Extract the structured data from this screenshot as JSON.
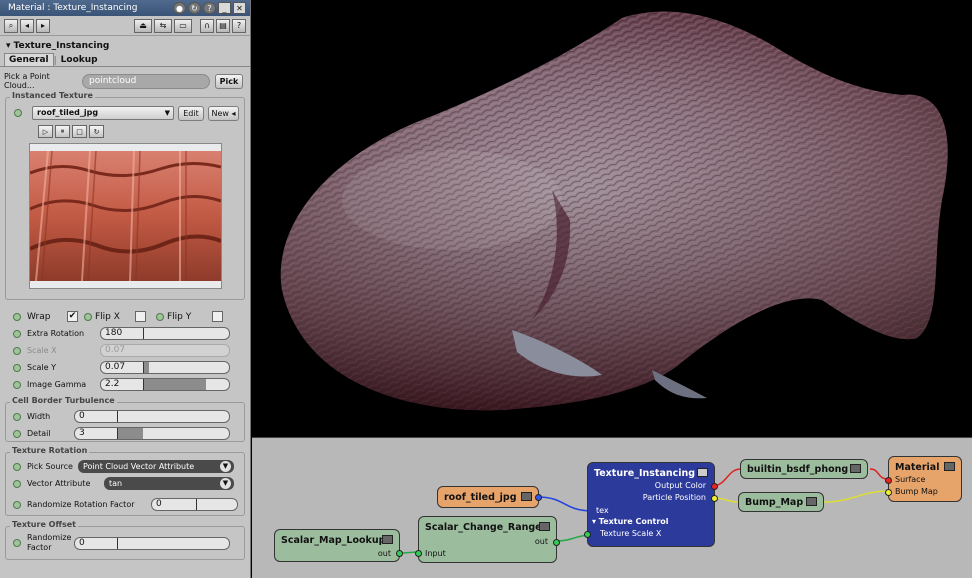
{
  "window": {
    "title": "Material : Texture_Instancing"
  },
  "panel": {
    "node_name": "Texture_Instancing",
    "tabs": [
      "General",
      "Lookup"
    ],
    "pick_label": "Pick a Point Cloud...",
    "pick_value": "pointcloud",
    "pick_button": "Pick",
    "instanced_texture": {
      "title": "Instanced Texture",
      "texture_name": "roof_tiled_jpg",
      "edit_label": "Edit",
      "new_label": "New"
    },
    "options": {
      "wrap_label": "Wrap",
      "wrap_checked": "✔",
      "flipx_label": "Flip X",
      "flipy_label": "Flip Y"
    },
    "params": {
      "extra_rotation": {
        "label": "Extra Rotation",
        "value": "180",
        "fraction": 0.5
      },
      "scale_x": {
        "label": "Scale X",
        "value": "0.07"
      },
      "scale_y": {
        "label": "Scale Y",
        "value": "0.07",
        "fraction": 0.07
      },
      "image_gamma": {
        "label": "Image Gamma",
        "value": "2.2",
        "fraction": 0.73
      }
    },
    "cell_border": {
      "title": "Cell Border Turbulence",
      "width": {
        "label": "Width",
        "value": "0",
        "fraction": 0
      },
      "detail": {
        "label": "Detail",
        "value": "3",
        "fraction": 0.23
      }
    },
    "rotation": {
      "title": "Texture Rotation",
      "pick_source_label": "Pick Source",
      "pick_source_value": "Point Cloud Vector Attribute",
      "vector_attr_label": "Vector Attribute",
      "vector_attr_value": "tan",
      "randomize_label": "Randomize Rotation Factor",
      "randomize_value": "0"
    },
    "offset": {
      "title": "Texture Offset",
      "randomize_label": "Randomize Factor",
      "randomize_value": "0"
    }
  },
  "graph": {
    "nodes": {
      "roof": {
        "title": "roof_tiled_jpg"
      },
      "texinst": {
        "title": "Texture_Instancing",
        "port_tex": "tex",
        "port_out_color": "Output Color",
        "port_particle": "Particle Position",
        "section": "▾ Texture Control",
        "port_scale": "Texture Scale X"
      },
      "phong": {
        "title": "builtin_bsdf_phong"
      },
      "bump": {
        "title": "Bump_Map"
      },
      "material": {
        "title": "Material",
        "port_surface": "Surface",
        "port_bump": "Bump Map"
      },
      "lookup": {
        "title": "Scalar_Map_Lookup",
        "port_out": "out"
      },
      "range": {
        "title": "Scalar_Change_Range",
        "port_in": "Input",
        "port_out": "out"
      }
    }
  }
}
